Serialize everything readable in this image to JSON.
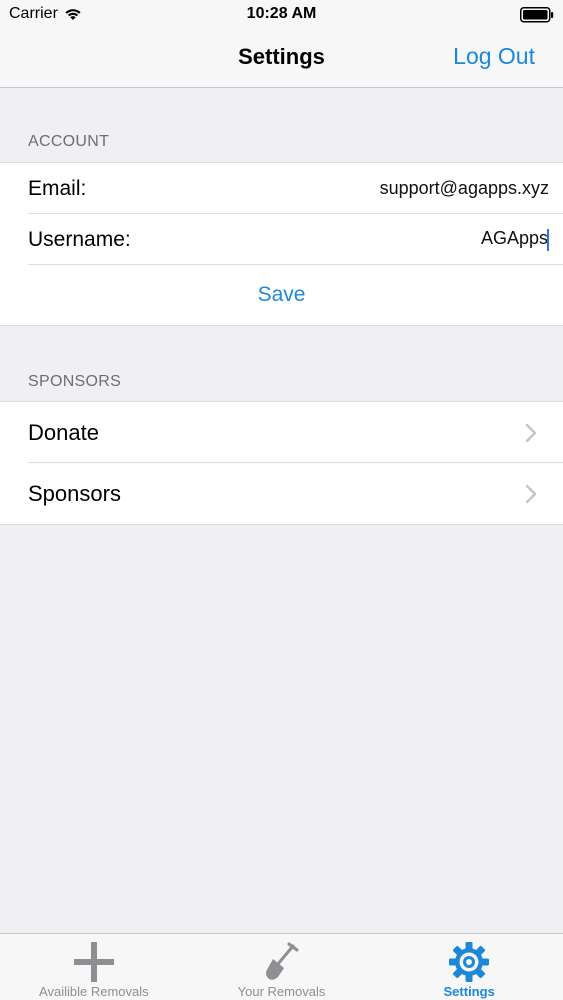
{
  "status_bar": {
    "carrier": "Carrier",
    "time": "10:28 AM"
  },
  "nav": {
    "title": "Settings",
    "right_button": "Log Out"
  },
  "account": {
    "header": "ACCOUNT",
    "email_label": "Email:",
    "email_value": "support@agapps.xyz",
    "username_label": "Username:",
    "username_value": "AGApps",
    "save_label": "Save"
  },
  "sponsors": {
    "header": "SPONSORS",
    "items": [
      {
        "label": "Donate",
        "icon": "chevron-right-icon"
      },
      {
        "label": "Sponsors",
        "icon": "chevron-right-icon"
      }
    ]
  },
  "tab_bar": {
    "tabs": [
      {
        "label": "Availible Removals",
        "icon": "plus-icon",
        "active": false
      },
      {
        "label": "Your Removals",
        "icon": "shovel-icon",
        "active": false
      },
      {
        "label": "Settings",
        "icon": "gear-icon",
        "active": true
      }
    ]
  },
  "colors": {
    "accent": "#1d87d8",
    "background": "#efeff4",
    "inactive": "#8e8e93"
  }
}
